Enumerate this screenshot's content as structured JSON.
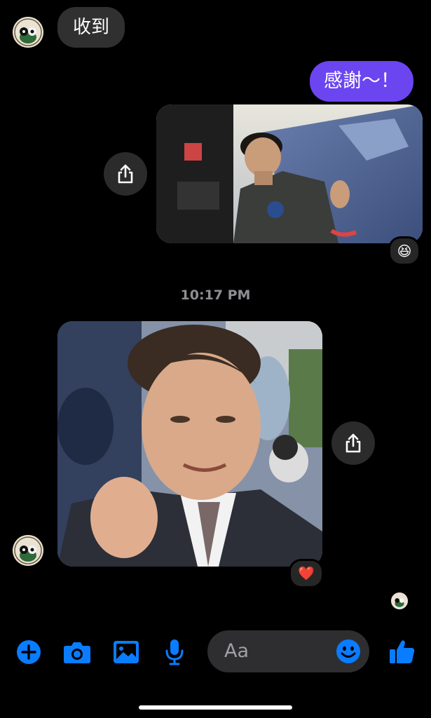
{
  "messages": {
    "incoming_text": "收到",
    "outgoing_text": "感謝～！",
    "reaction_1": "😆",
    "timestamp": "10:17 PM",
    "reaction_2": "❤️"
  },
  "composer": {
    "placeholder": "Aa"
  },
  "icons": {
    "add": "plus-circle-icon",
    "camera": "camera-icon",
    "gallery": "image-icon",
    "mic": "microphone-icon",
    "emoji": "emoji-icon",
    "like": "thumbs-up-icon",
    "share": "share-icon"
  },
  "colors": {
    "accent": "#0a7cff",
    "outgoing_bubble": "#6b45f0",
    "incoming_bubble": "#303030"
  }
}
